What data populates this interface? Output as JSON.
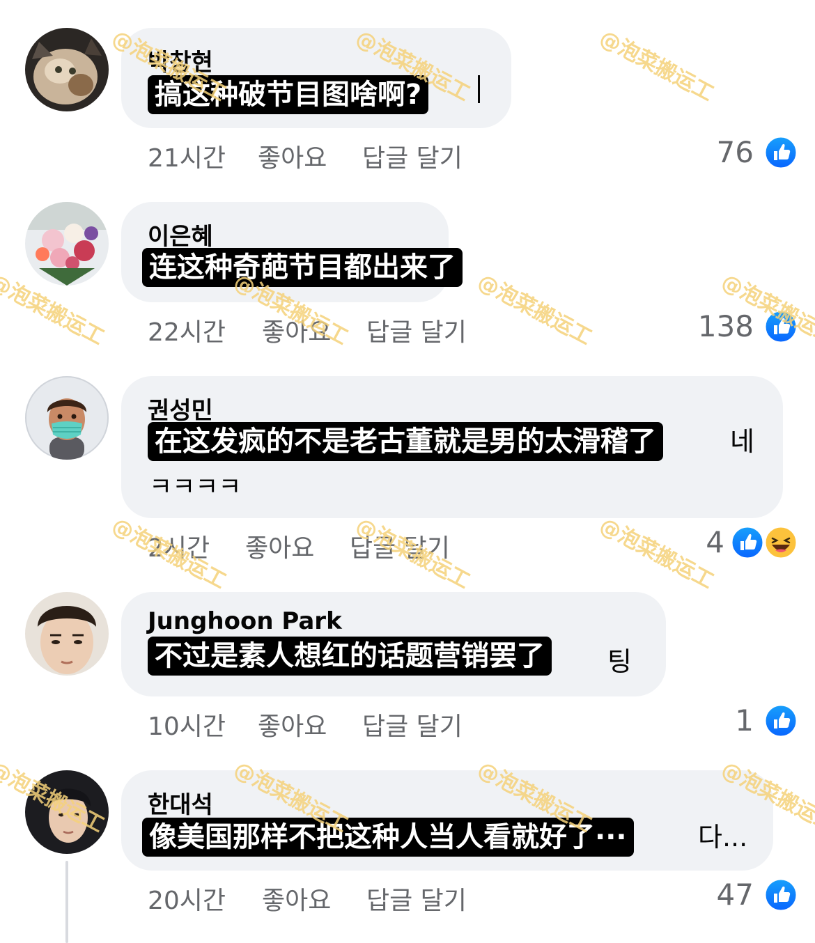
{
  "watermark": "@泡菜搬运工",
  "comments": [
    {
      "author": "박창현",
      "overlay": "搞这种破节目图啥啊?",
      "tail": "",
      "line2": "",
      "time": "21시간",
      "like_label": "좋아요",
      "reply_label": "답글 달기",
      "count": "76",
      "avatar": "cat-photo"
    },
    {
      "author": "이은혜",
      "overlay": "连这种奇葩节目都出来了",
      "tail": "",
      "line2": "",
      "time": "22시간",
      "like_label": "좋아요",
      "reply_label": "답글 달기",
      "count": "138",
      "avatar": "flower-bouquet-photo"
    },
    {
      "author": "권성민",
      "overlay": "在这发疯的不是老古董就是男的太滑稽了",
      "tail": "네",
      "line2": "ㅋㅋㅋㅋ",
      "time": "2시간",
      "like_label": "좋아요",
      "reply_label": "답글 달기",
      "count": "4",
      "avatar": "memoji-with-mask"
    },
    {
      "author": "Junghoon Park",
      "overlay": "不过是素人想红的话题营销罢了",
      "tail": "팅",
      "line2": "",
      "time": "10시간",
      "like_label": "좋아요",
      "reply_label": "답글 달기",
      "count": "1",
      "avatar": "man-face-photo"
    },
    {
      "author": "한대석",
      "overlay": "像美国那样不把这种人当人看就好了···",
      "tail": "다...",
      "line2": "",
      "time": "20시간",
      "like_label": "좋아요",
      "reply_label": "답글 달기",
      "count": "47",
      "avatar": "person-photo"
    }
  ],
  "colors": {
    "like_blue": "#1877f2",
    "bubble_bg": "#f0f2f5",
    "meta_gray": "#65676b",
    "watermark": "#f5d27a"
  }
}
